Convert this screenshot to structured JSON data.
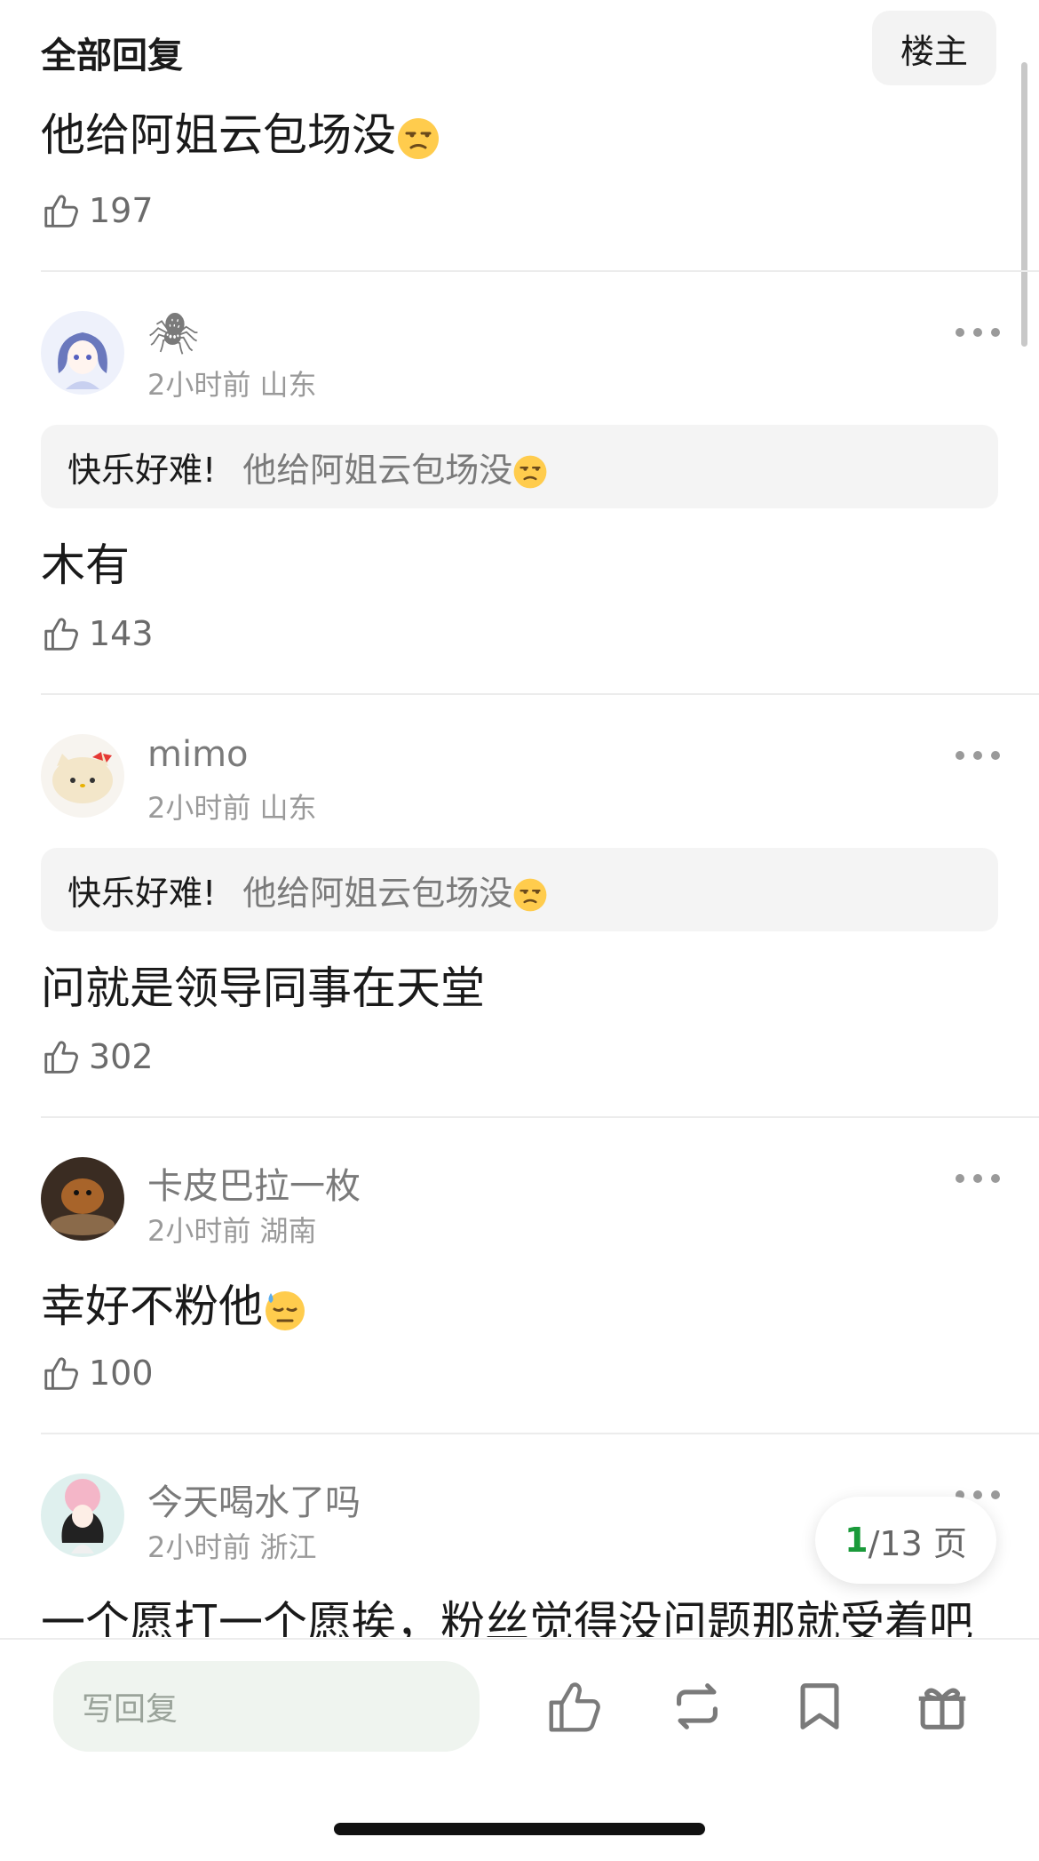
{
  "header": {
    "title": "全部回复",
    "owner_button": "楼主"
  },
  "top_post": {
    "text": "他给阿姐云包场没",
    "likes": "197"
  },
  "comments": [
    {
      "username": "🕷",
      "time": "2小时前",
      "location": "山东",
      "quote_author": "快乐好难!",
      "quote_text": "他给阿姐云包场没",
      "text": "木有",
      "likes": "143"
    },
    {
      "username": "mimo",
      "time": "2小时前",
      "location": "山东",
      "quote_author": "快乐好难!",
      "quote_text": "他给阿姐云包场没",
      "text": "问就是领导同事在天堂",
      "likes": "302"
    },
    {
      "username": "卡皮巴拉一枚",
      "time": "2小时前",
      "location": "湖南",
      "text": "幸好不粉他",
      "likes": "100"
    },
    {
      "username": "今天喝水了吗",
      "time": "2小时前",
      "location": "浙江",
      "text": "一个愿打一个愿挨，粉丝觉得没问题那就受着吧"
    }
  ],
  "pager": {
    "current": "1",
    "total": "/13 页"
  },
  "bottom_bar": {
    "reply_placeholder": "写回复"
  },
  "colors": {
    "accent_green": "#1a9a3a",
    "reply_bg": "#eff4ef"
  },
  "icons": [
    "thumbs-up-icon",
    "more-dots-icon",
    "repost-icon",
    "bookmark-icon",
    "gift-icon",
    "unamused-emoji-icon",
    "sweat-emoji-icon"
  ]
}
